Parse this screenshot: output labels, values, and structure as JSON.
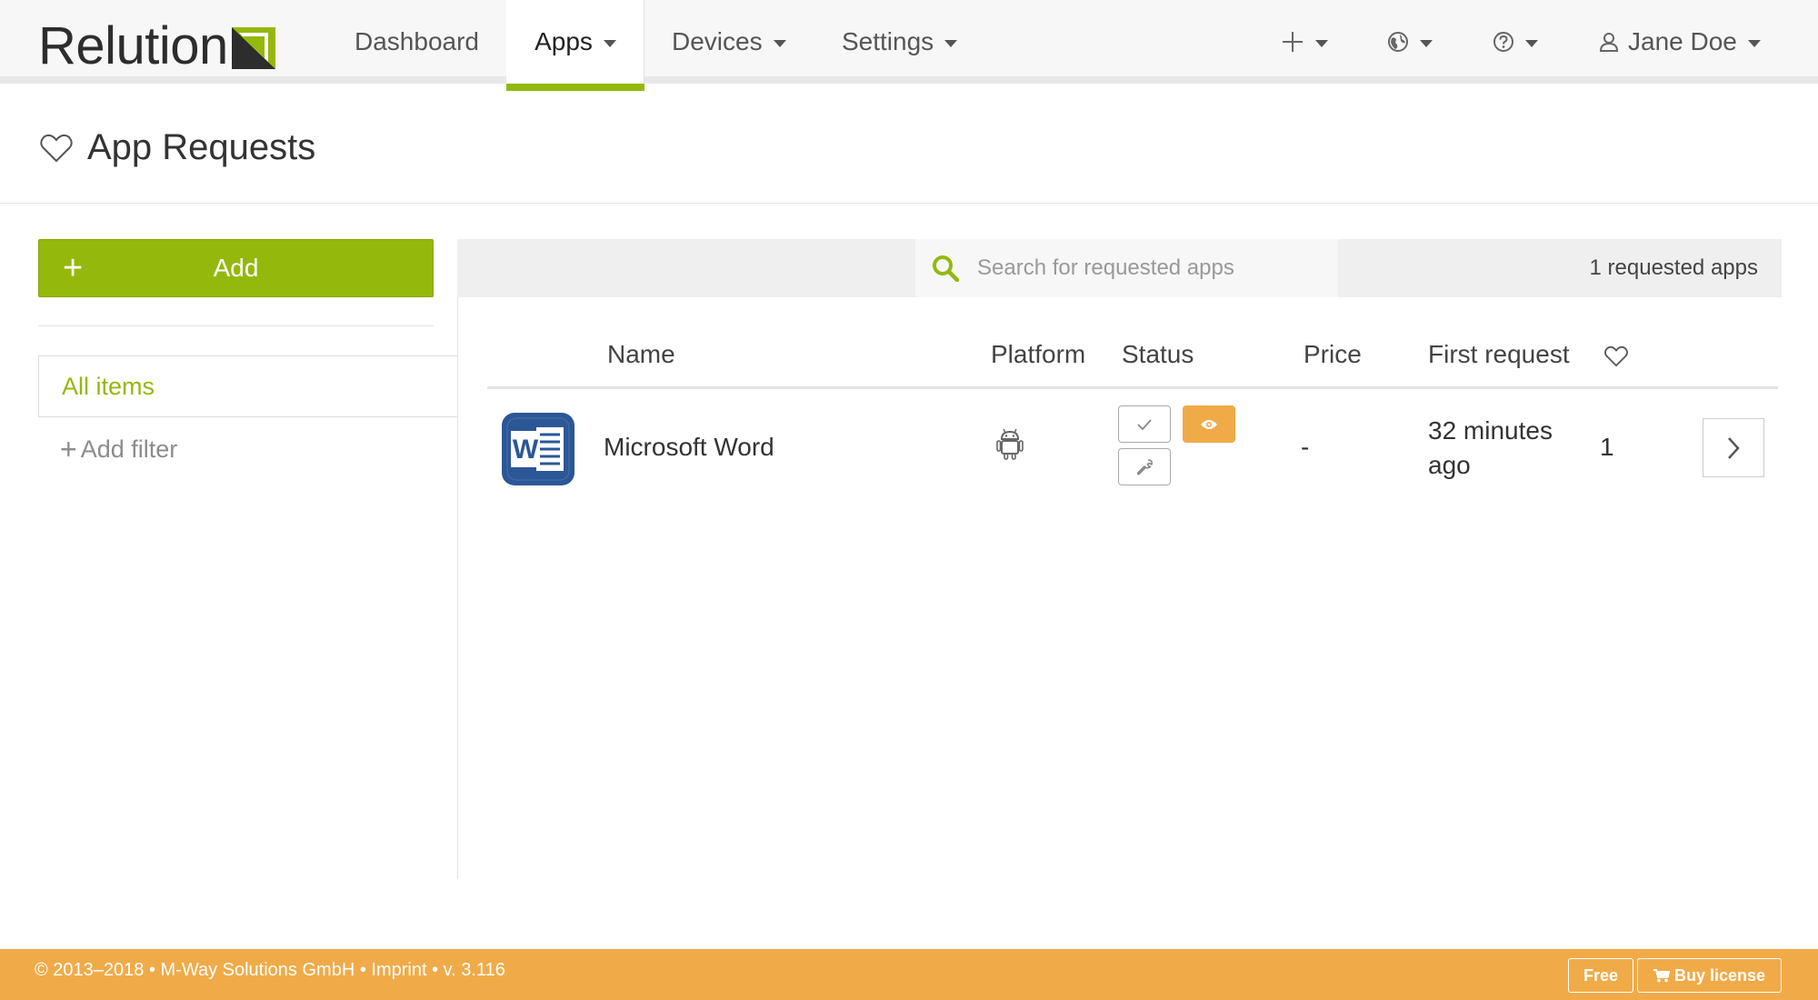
{
  "app": {
    "logo_text": "Relution"
  },
  "nav": {
    "items": [
      {
        "label": "Dashboard"
      },
      {
        "label": "Apps"
      },
      {
        "label": "Devices"
      },
      {
        "label": "Settings"
      }
    ],
    "user_name": "Jane Doe"
  },
  "page": {
    "title": "App Requests"
  },
  "sidebar": {
    "add_label": "Add",
    "filter_item": "All items",
    "add_filter_label": "Add filter"
  },
  "toolbar": {
    "search_placeholder": "Search for requested apps",
    "count_label": "1 requested apps"
  },
  "table": {
    "columns": [
      "Name",
      "Platform",
      "Status",
      "Price",
      "First request"
    ],
    "rows": [
      {
        "name": "Microsoft Word",
        "platform_icon": "android-icon",
        "price": "-",
        "first_request_line1": "32 minutes",
        "first_request_line2": "ago",
        "likes": "1"
      }
    ]
  },
  "footer": {
    "copyright": "© 2013–2018 • M-Way Solutions GmbH • Imprint • v. 3.116",
    "free_label": "Free",
    "buy_label": "Buy license"
  },
  "colors": {
    "brand_green": "#94b80c",
    "footer_orange": "#f0ab48",
    "word_blue": "#2b5797"
  }
}
